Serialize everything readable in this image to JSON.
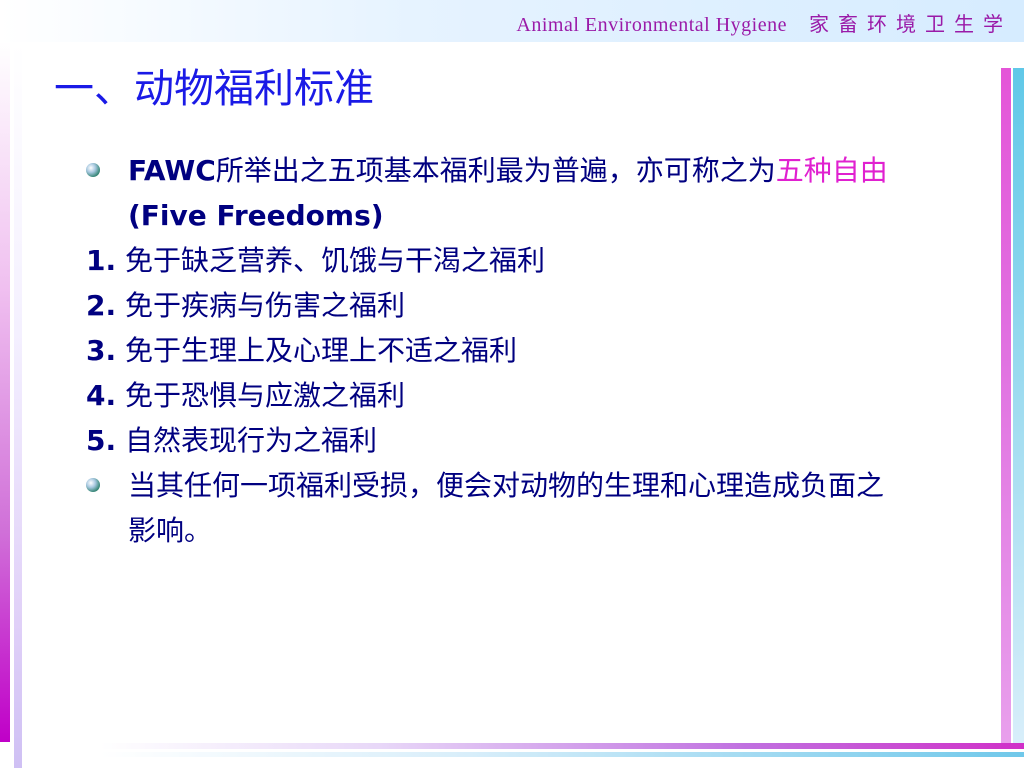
{
  "header": {
    "english_title": "Animal  Environmental  Hygiene",
    "chinese_title": "家畜环境卫生学"
  },
  "slide": {
    "title": "一、动物福利标准",
    "bullet1": {
      "bold_prefix": "FAWC",
      "text_a": "所举出之五项基本福利最为普遍，亦可称之为",
      "highlight": "五种自由",
      "bold_suffix": "(Five Freedoms)"
    },
    "freedoms": [
      {
        "num": "1.",
        "text": "免于缺乏营养、饥饿与干渴之福利"
      },
      {
        "num": "2.",
        "text": "免于疾病与伤害之福利"
      },
      {
        "num": "3.",
        "text": "免于生理上及心理上不适之福利"
      },
      {
        "num": "4.",
        "text": "免于恐惧与应激之福利"
      },
      {
        "num": "5.",
        "text": "自然表现行为之福利"
      }
    ],
    "bullet2": {
      "text": "当其任何一项福利受损，便会对动物的生理和心理造成负面之影响。"
    }
  },
  "colors": {
    "title": "#1a1ae6",
    "body": "#000080",
    "highlight": "#e020d0",
    "header_text": "#9a1aa8"
  }
}
